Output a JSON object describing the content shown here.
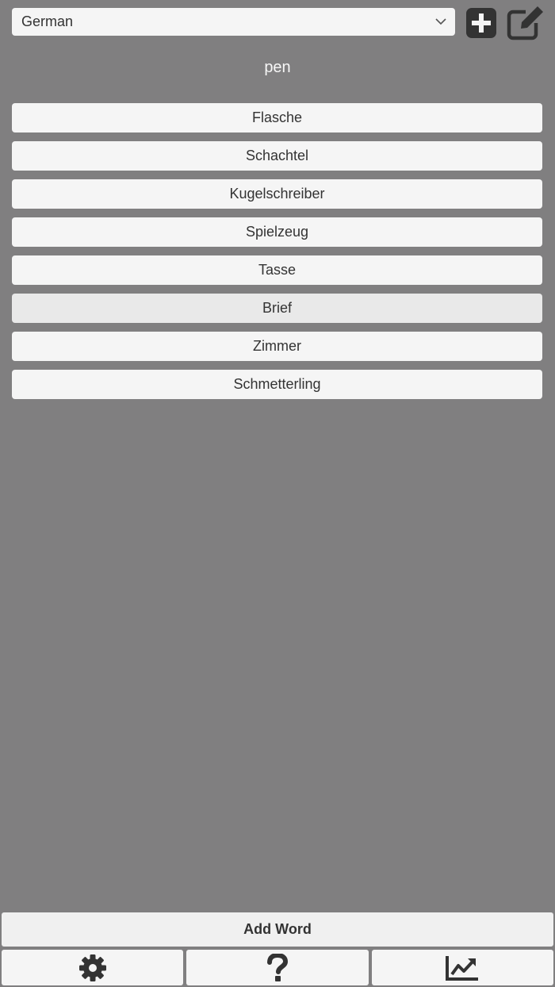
{
  "language_select": {
    "value": "German",
    "icon": "chevron-down-icon"
  },
  "toolbar": {
    "add_icon": "plus-square-icon",
    "edit_icon": "edit-icon"
  },
  "prompt": {
    "word": "pen"
  },
  "choices": [
    {
      "label": "Flasche"
    },
    {
      "label": "Schachtel"
    },
    {
      "label": "Kugelschreiber"
    },
    {
      "label": "Spielzeug"
    },
    {
      "label": "Tasse"
    },
    {
      "label": "Brief",
      "highlighted": true
    },
    {
      "label": "Zimmer"
    },
    {
      "label": "Schmetterling"
    }
  ],
  "add_word": {
    "label": "Add Word"
  },
  "bottom_bar": [
    {
      "icon": "gear-icon"
    },
    {
      "icon": "question-icon"
    },
    {
      "icon": "chart-icon"
    }
  ],
  "colors": {
    "background": "#807f80",
    "button": "#f5f5f5",
    "text": "#333333",
    "icon": "#333333"
  }
}
